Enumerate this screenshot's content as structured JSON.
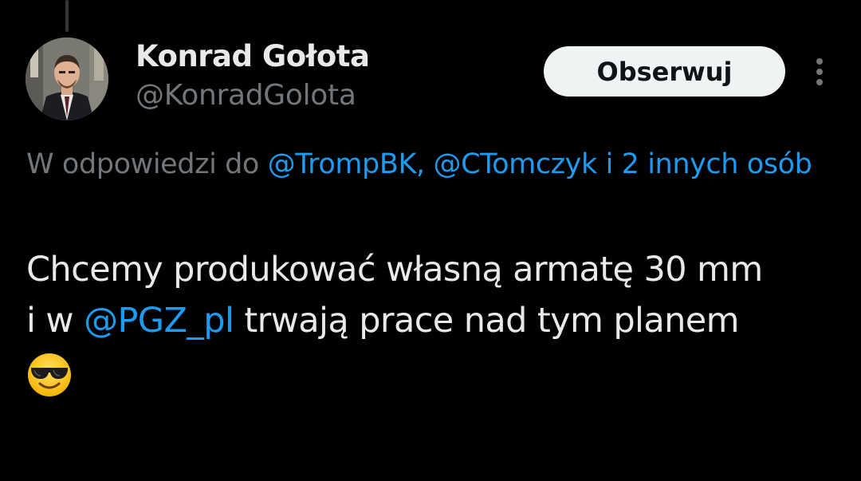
{
  "author": {
    "display_name": "Konrad Gołota",
    "handle": "@KonradGolota",
    "avatar_icon": "profile-photo"
  },
  "actions": {
    "follow_label": "Obserwuj",
    "more_icon": "more-vertical-icon"
  },
  "reply_context": {
    "prefix": "W odpowiedzi do ",
    "mentions": [
      "@TrompBK",
      "@CTomczyk"
    ],
    "separator": ", ",
    "others": "i 2 innych osób"
  },
  "tweet": {
    "line1": "Chcemy produkować własną armatę 30 mm",
    "line2_prefix": "i w ",
    "line2_mention": "@PGZ_pl",
    "line2_suffix": " trwają prace nad tym planem",
    "emoji": "smiling-face-with-sunglasses-icon"
  },
  "colors": {
    "background": "#000000",
    "text_primary": "#e7e9ea",
    "text_secondary": "#71767b",
    "link": "#1d9bf0",
    "button_bg": "#eff3f4",
    "button_text": "#0f1419"
  }
}
